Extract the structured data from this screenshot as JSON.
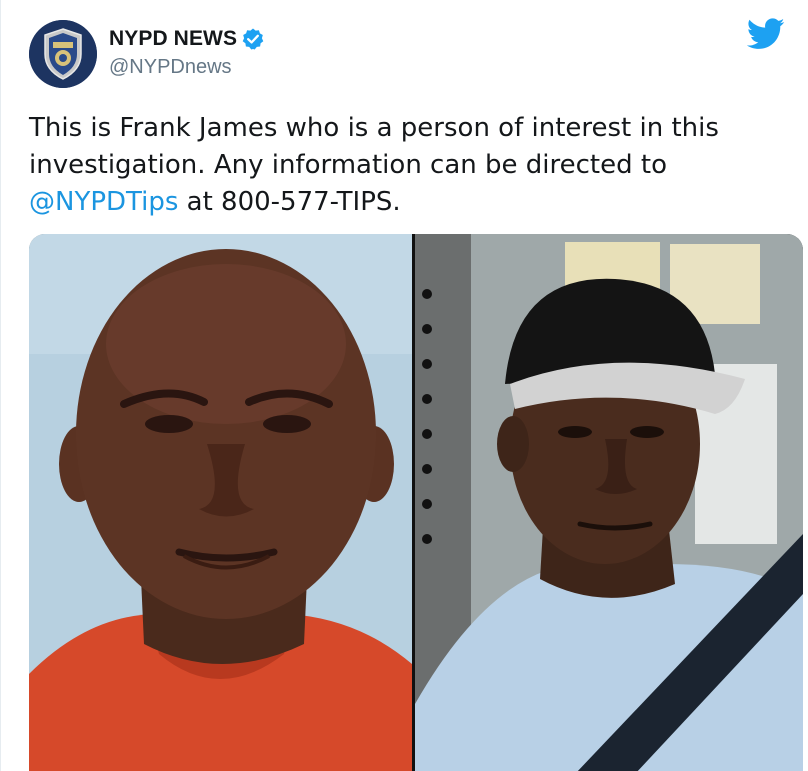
{
  "account": {
    "display_name": "NYPD NEWS",
    "handle": "@NYPDnews",
    "verified": true,
    "avatar_icon": "nypd-badge-icon",
    "brand_icon": "twitter-bird-icon",
    "colors": {
      "accent": "#1da1f2",
      "link": "#1b95e0",
      "name": "#14171a",
      "handle": "#657786"
    }
  },
  "tweet": {
    "line1": "This is Frank James who is a person of interest in this",
    "line2": "investigation. Any information can be directed to",
    "mention": "@NYPDTips",
    "line3_rest": " at 800-577-TIPS."
  },
  "media": {
    "photos": [
      {
        "icon": "mugshot-photo"
      },
      {
        "icon": "selfie-photo"
      }
    ]
  }
}
